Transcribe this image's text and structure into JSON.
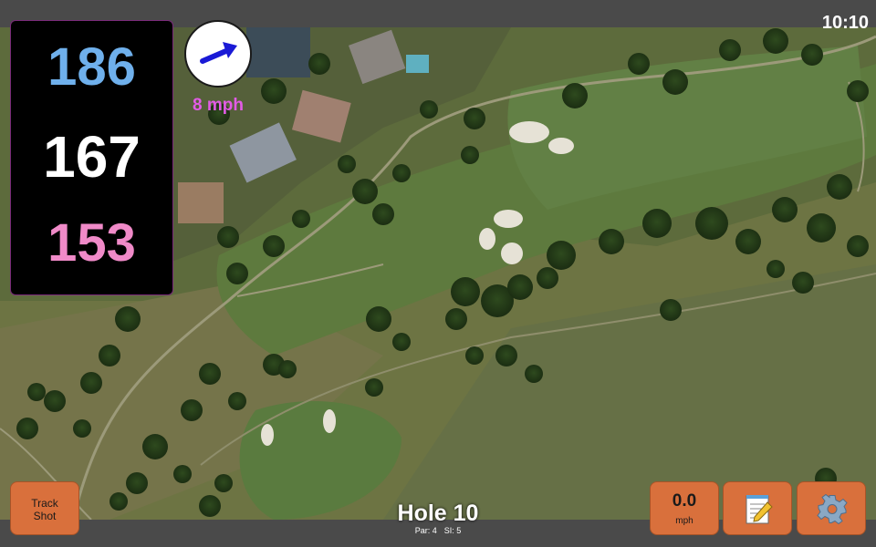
{
  "status": {
    "time": "10:10"
  },
  "yardage": {
    "back": "186",
    "middle": "167",
    "front": "153"
  },
  "wind": {
    "speed": "8 mph",
    "icon": "wind-direction-arrow-icon",
    "arrow_color": "#1a1ad6"
  },
  "hole": {
    "title": "Hole 10",
    "par": "Par: 4",
    "si": "SI: 5"
  },
  "buttons": {
    "track_shot": "Track Shot",
    "speed_value": "0.0",
    "speed_unit": "mph",
    "notes_icon": "notepad-icon",
    "settings_icon": "gear-icon"
  },
  "colors": {
    "button": "#d9703c",
    "back": "#6fb0ec",
    "middle": "#ffffff",
    "front": "#f08ac8",
    "wind_text": "#e25be6"
  }
}
